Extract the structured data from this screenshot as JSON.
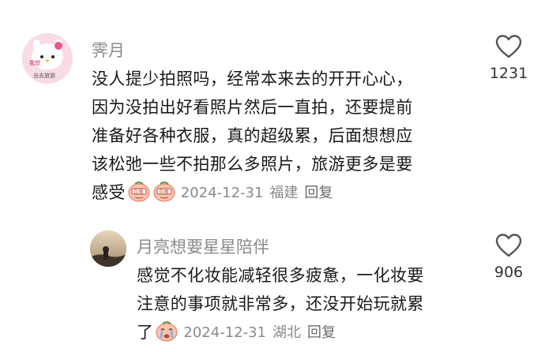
{
  "comments": [
    {
      "username": "霁月",
      "lines": [
        "没人提少拍照吗，经常本来去的开开心心，",
        "因为没拍出好看照片然后一直拍，还要提前",
        "准备好各种衣服，真的超级累，后面想想应",
        "该松弛一些不拍那么多照片，旅游更多是要",
        "感受"
      ],
      "emojis": [
        "peach-emoji",
        "peach-emoji"
      ],
      "date": "2024-12-31",
      "location": "福建",
      "reply_label": "回复",
      "likes": "1231",
      "avatar_text": "我想出 旅游"
    },
    {
      "username": "月亮想要星星陪伴",
      "lines": [
        "感觉不化妆能减轻很多疲惫，一化妆要",
        "注意的事项就非常多，还没开始玩就累",
        "了"
      ],
      "emojis": [
        "crying-peach-emoji"
      ],
      "date": "2024-12-31",
      "location": "湖北",
      "reply_label": "回复",
      "likes": "906"
    }
  ],
  "colors": {
    "username": "#8a8a8a",
    "text": "#1a1a1a",
    "meta": "#8a8a8a"
  }
}
